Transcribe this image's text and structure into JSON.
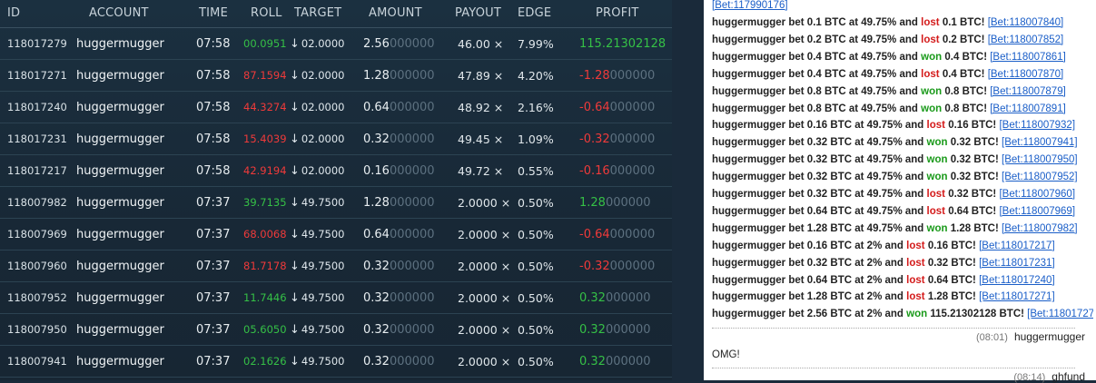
{
  "headers": {
    "id": "ID",
    "account": "ACCOUNT",
    "time": "TIME",
    "roll": "ROLL",
    "target": "TARGET",
    "amount": "AMOUNT",
    "payout": "PAYOUT",
    "edge": "EDGE",
    "profit": "PROFIT"
  },
  "bets": [
    {
      "id": "118017279",
      "account": "huggermugger",
      "time": "07:58",
      "roll_main": "00.0951",
      "roll_result": "win",
      "target": "02.0000",
      "amount_main": "2.56",
      "amount_dim": "000000",
      "payout": "46.00 ×",
      "edge": "7.99%",
      "profit_main": "115.21302128",
      "profit_dim": "",
      "profit_result": "win"
    },
    {
      "id": "118017271",
      "account": "huggermugger",
      "time": "07:58",
      "roll_main": "87.1594",
      "roll_result": "loss",
      "target": "02.0000",
      "amount_main": "1.28",
      "amount_dim": "000000",
      "payout": "47.89 ×",
      "edge": "4.20%",
      "profit_main": "-1.28",
      "profit_dim": "000000",
      "profit_result": "loss"
    },
    {
      "id": "118017240",
      "account": "huggermugger",
      "time": "07:58",
      "roll_main": "44.3274",
      "roll_result": "loss",
      "target": "02.0000",
      "amount_main": "0.64",
      "amount_dim": "000000",
      "payout": "48.92 ×",
      "edge": "2.16%",
      "profit_main": "-0.64",
      "profit_dim": "000000",
      "profit_result": "loss"
    },
    {
      "id": "118017231",
      "account": "huggermugger",
      "time": "07:58",
      "roll_main": "15.4039",
      "roll_result": "loss",
      "target": "02.0000",
      "amount_main": "0.32",
      "amount_dim": "000000",
      "payout": "49.45 ×",
      "edge": "1.09%",
      "profit_main": "-0.32",
      "profit_dim": "000000",
      "profit_result": "loss"
    },
    {
      "id": "118017217",
      "account": "huggermugger",
      "time": "07:58",
      "roll_main": "42.9194",
      "roll_result": "loss",
      "target": "02.0000",
      "amount_main": "0.16",
      "amount_dim": "000000",
      "payout": "49.72 ×",
      "edge": "0.55%",
      "profit_main": "-0.16",
      "profit_dim": "000000",
      "profit_result": "loss"
    },
    {
      "id": "118007982",
      "account": "huggermugger",
      "time": "07:37",
      "roll_main": "39.7135",
      "roll_result": "win",
      "target": "49.7500",
      "amount_main": "1.28",
      "amount_dim": "000000",
      "payout": "2.0000 ×",
      "edge": "0.50%",
      "profit_main": "1.28",
      "profit_dim": "000000",
      "profit_result": "win"
    },
    {
      "id": "118007969",
      "account": "huggermugger",
      "time": "07:37",
      "roll_main": "68.0068",
      "roll_result": "loss",
      "target": "49.7500",
      "amount_main": "0.64",
      "amount_dim": "000000",
      "payout": "2.0000 ×",
      "edge": "0.50%",
      "profit_main": "-0.64",
      "profit_dim": "000000",
      "profit_result": "loss"
    },
    {
      "id": "118007960",
      "account": "huggermugger",
      "time": "07:37",
      "roll_main": "81.7178",
      "roll_result": "loss",
      "target": "49.7500",
      "amount_main": "0.32",
      "amount_dim": "000000",
      "payout": "2.0000 ×",
      "edge": "0.50%",
      "profit_main": "-0.32",
      "profit_dim": "000000",
      "profit_result": "loss"
    },
    {
      "id": "118007952",
      "account": "huggermugger",
      "time": "07:37",
      "roll_main": "11.7446",
      "roll_result": "win",
      "target": "49.7500",
      "amount_main": "0.32",
      "amount_dim": "000000",
      "payout": "2.0000 ×",
      "edge": "0.50%",
      "profit_main": "0.32",
      "profit_dim": "000000",
      "profit_result": "win"
    },
    {
      "id": "118007950",
      "account": "huggermugger",
      "time": "07:37",
      "roll_main": "05.6050",
      "roll_result": "win",
      "target": "49.7500",
      "amount_main": "0.32",
      "amount_dim": "000000",
      "payout": "2.0000 ×",
      "edge": "0.50%",
      "profit_main": "0.32",
      "profit_dim": "000000",
      "profit_result": "win"
    },
    {
      "id": "118007941",
      "account": "huggermugger",
      "time": "07:37",
      "roll_main": "02.1626",
      "roll_result": "win",
      "target": "49.7500",
      "amount_main": "0.32",
      "amount_dim": "000000",
      "payout": "2.0000 ×",
      "edge": "0.50%",
      "profit_main": "0.32",
      "profit_dim": "000000",
      "profit_result": "win"
    }
  ],
  "chat": {
    "top_link": "[Bet:117990176]",
    "lines": [
      {
        "user": "huggermugger",
        "amount": "0.1",
        "chance": "49.75%",
        "result": "lost",
        "win_amount": "0.1",
        "link": "[Bet:118007840]"
      },
      {
        "user": "huggermugger",
        "amount": "0.2",
        "chance": "49.75%",
        "result": "lost",
        "win_amount": "0.2",
        "link": "[Bet:118007852]"
      },
      {
        "user": "huggermugger",
        "amount": "0.4",
        "chance": "49.75%",
        "result": "won",
        "win_amount": "0.4",
        "link": "[Bet:118007861]"
      },
      {
        "user": "huggermugger",
        "amount": "0.4",
        "chance": "49.75%",
        "result": "lost",
        "win_amount": "0.4",
        "link": "[Bet:118007870]"
      },
      {
        "user": "huggermugger",
        "amount": "0.8",
        "chance": "49.75%",
        "result": "won",
        "win_amount": "0.8",
        "link": "[Bet:118007879]"
      },
      {
        "user": "huggermugger",
        "amount": "0.8",
        "chance": "49.75%",
        "result": "won",
        "win_amount": "0.8",
        "link": "[Bet:118007891]"
      },
      {
        "user": "huggermugger",
        "amount": "0.16",
        "chance": "49.75%",
        "result": "lost",
        "win_amount": "0.16",
        "link": "[Bet:118007932]"
      },
      {
        "user": "huggermugger",
        "amount": "0.32",
        "chance": "49.75%",
        "result": "won",
        "win_amount": "0.32",
        "link": "[Bet:118007941]"
      },
      {
        "user": "huggermugger",
        "amount": "0.32",
        "chance": "49.75%",
        "result": "won",
        "win_amount": "0.32",
        "link": "[Bet:118007950]"
      },
      {
        "user": "huggermugger",
        "amount": "0.32",
        "chance": "49.75%",
        "result": "won",
        "win_amount": "0.32",
        "link": "[Bet:118007952]"
      },
      {
        "user": "huggermugger",
        "amount": "0.32",
        "chance": "49.75%",
        "result": "lost",
        "win_amount": "0.32",
        "link": "[Bet:118007960]"
      },
      {
        "user": "huggermugger",
        "amount": "0.64",
        "chance": "49.75%",
        "result": "lost",
        "win_amount": "0.64",
        "link": "[Bet:118007969]"
      },
      {
        "user": "huggermugger",
        "amount": "1.28",
        "chance": "49.75%",
        "result": "won",
        "win_amount": "1.28",
        "link": "[Bet:118007982]"
      },
      {
        "user": "huggermugger",
        "amount": "0.16",
        "chance": "2%",
        "result": "lost",
        "win_amount": "0.16",
        "link": "[Bet:118017217]"
      },
      {
        "user": "huggermugger",
        "amount": "0.32",
        "chance": "2%",
        "result": "lost",
        "win_amount": "0.32",
        "link": "[Bet:118017231]"
      },
      {
        "user": "huggermugger",
        "amount": "0.64",
        "chance": "2%",
        "result": "lost",
        "win_amount": "0.64",
        "link": "[Bet:118017240]"
      },
      {
        "user": "huggermugger",
        "amount": "1.28",
        "chance": "2%",
        "result": "lost",
        "win_amount": "1.28",
        "link": "[Bet:118017271]"
      },
      {
        "user": "huggermugger",
        "amount": "2.56",
        "chance": "2%",
        "result": "won",
        "win_amount": "115.21302128",
        "link": "[Bet:118017279]"
      }
    ],
    "messages": [
      {
        "time": "(08:01)",
        "user": "huggermugger",
        "text": "OMG!"
      },
      {
        "time": "(08:14)",
        "user": "ghfund",
        "text": ""
      }
    ],
    "words": {
      "bet": "bet",
      "btc": "BTC",
      "at": "at",
      "and": "and",
      "btc_end": "BTC!"
    }
  },
  "colors": {
    "win": "#35c046",
    "loss": "#ef3a3a",
    "chat_won": "#1a9a1a",
    "chat_lost": "#d41b1b",
    "link": "#1a5ec8"
  },
  "icons": {
    "target_arrow": "arrow-down-icon"
  }
}
